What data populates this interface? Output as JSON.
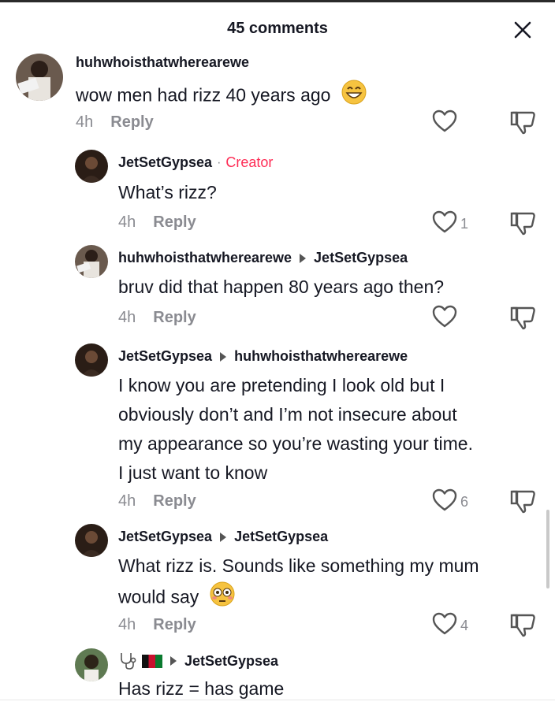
{
  "header": {
    "title": "45 comments",
    "close_icon": "close-icon"
  },
  "comments": [
    {
      "username": "huhwhoisthatwherearewe",
      "text": "wow men had rizz 40 years ago",
      "emoji": "grinning-face-icon",
      "time": "4h",
      "reply": "Reply",
      "likes": ""
    },
    {
      "username": "JetSetGypsea",
      "badge": "Creator",
      "text": "What’s rizz?",
      "time": "4h",
      "reply": "Reply",
      "likes": "1"
    },
    {
      "username": "huhwhoisthatwherearewe",
      "reply_to": "JetSetGypsea",
      "text": "bruv did that happen 80 years ago then?",
      "time": "4h",
      "reply": "Reply",
      "likes": ""
    },
    {
      "username": "JetSetGypsea",
      "reply_to": "huhwhoisthatwherearewe",
      "lines": [
        "I know you are pretending I look old but I",
        "obviously don’t and I’m not insecure about",
        "my appearance so you’re wasting your time.",
        "I just want to know"
      ],
      "time": "4h",
      "reply": "Reply",
      "likes": "6"
    },
    {
      "username": "JetSetGypsea",
      "reply_to": "JetSetGypsea",
      "lines": [
        "What rizz is. Sounds like something my mum",
        "would say"
      ],
      "emoji": "flushed-face-icon",
      "time": "4h",
      "reply": "Reply",
      "likes": "4"
    },
    {
      "username_icons": [
        "stethoscope-icon",
        "afghanistan-flag-icon"
      ],
      "reply_to": "JetSetGypsea",
      "text": "Has rizz = has game"
    }
  ]
}
